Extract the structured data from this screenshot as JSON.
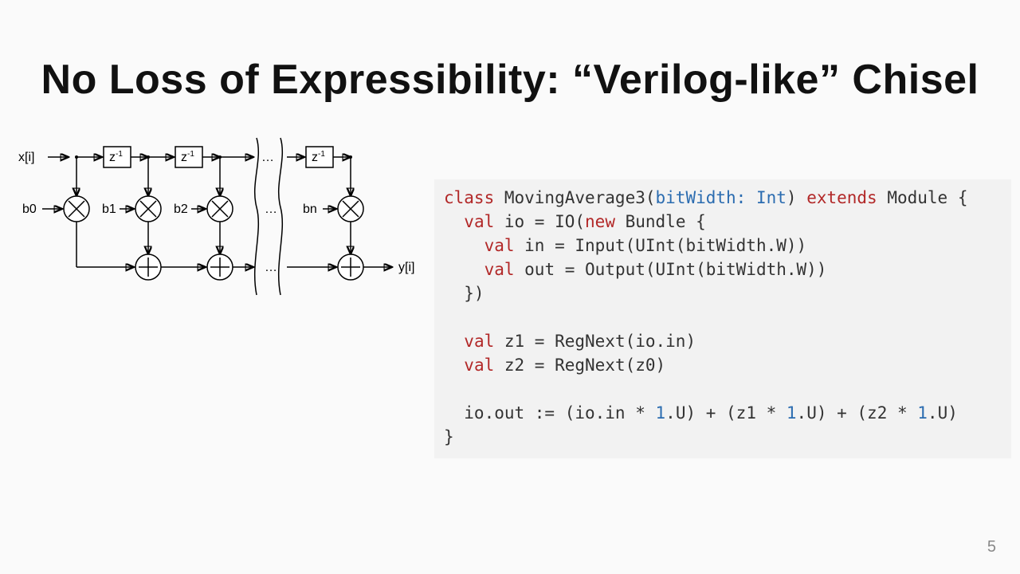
{
  "slide": {
    "title": "No Loss of Expressibility: “Verilog-like” Chisel",
    "page_number": "5"
  },
  "diagram": {
    "input_label": "x[i]",
    "delay_label": "z",
    "delay_sup": "-1",
    "coeff_labels": [
      "b0",
      "b1",
      "b2",
      "bn"
    ],
    "ellipsis": "…",
    "output_label": "y[i]"
  },
  "code": {
    "l1_a": "class",
    "l1_b": " MovingAverage3(",
    "l1_c": "bitWidth: Int",
    "l1_d": ") ",
    "l1_e": "extends",
    "l1_f": " Module {",
    "l2_a": "  ",
    "l2_b": "val",
    "l2_c": " io = IO(",
    "l2_d": "new",
    "l2_e": " Bundle {",
    "l3_a": "    ",
    "l3_b": "val",
    "l3_c": " in = Input(UInt(bitWidth.W))",
    "l4_a": "    ",
    "l4_b": "val",
    "l4_c": " out = Output(UInt(bitWidth.W))",
    "l5": "  })",
    "l6": "",
    "l7_a": "  ",
    "l7_b": "val",
    "l7_c": " z1 = RegNext(io.in)",
    "l8_a": "  ",
    "l8_b": "val",
    "l8_c": " z2 = RegNext(z0)",
    "l9": "",
    "l10_a": "  io.out := (io.in * ",
    "l10_b": "1",
    "l10_c": ".U) + (z1 * ",
    "l10_d": "1",
    "l10_e": ".U) + (z2 * ",
    "l10_f": "1",
    "l10_g": ".U)",
    "l11": "}"
  }
}
